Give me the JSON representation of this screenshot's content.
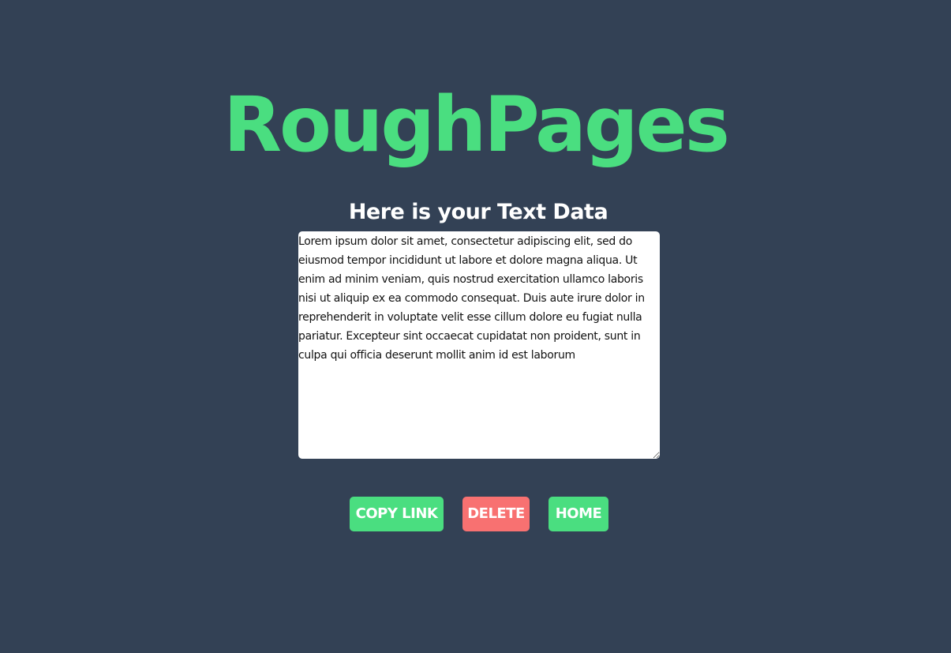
{
  "app": {
    "brand": "RoughPages"
  },
  "main": {
    "heading": "Here is your Text Data",
    "text_content": "Lorem ipsum dolor sit amet, consectetur adipiscing elit, sed do eiusmod tempor incididunt ut labore et dolore magna aliqua. Ut enim ad minim veniam, quis nostrud exercitation ullamco laboris nisi ut aliquip ex ea commodo consequat. Duis aute irure dolor in reprehenderit in voluptate velit esse cillum dolore eu fugiat nulla pariatur. Excepteur sint occaecat cupidatat non proident, sunt in culpa qui officia deserunt mollit anim id est laborum"
  },
  "actions": {
    "copy_link_label": "COPY LINK",
    "delete_label": "DELETE",
    "home_label": "HOME"
  },
  "colors": {
    "background": "#334155",
    "accent": "#4ade80",
    "danger": "#f87171",
    "text_light": "#ffffff"
  }
}
